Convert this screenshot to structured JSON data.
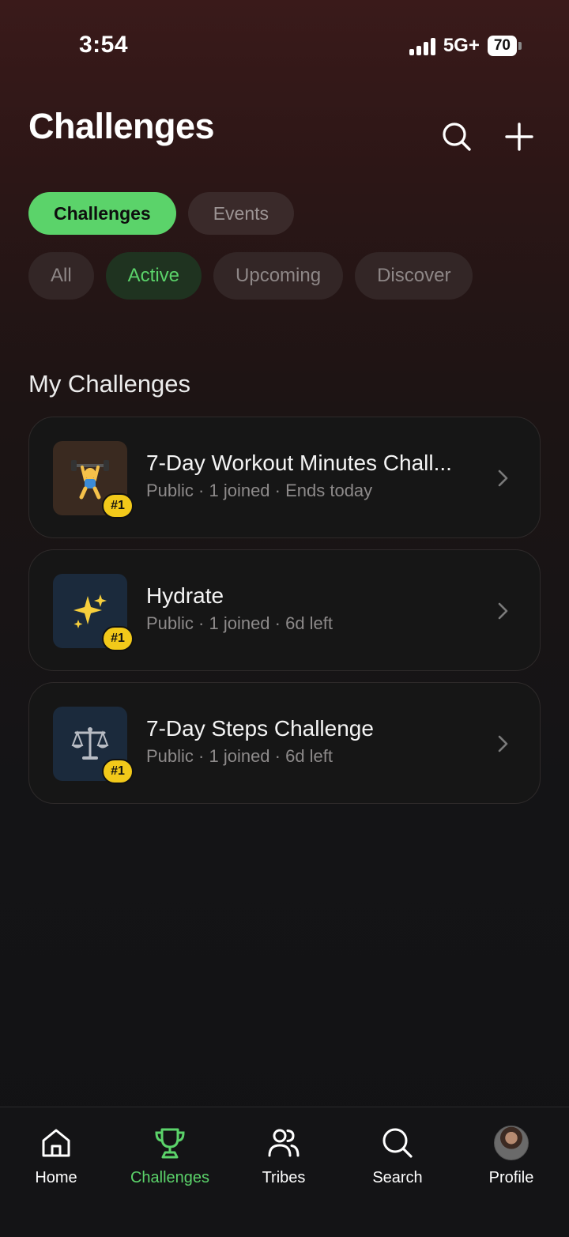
{
  "status": {
    "time": "3:54",
    "network": "5G+",
    "battery": "70"
  },
  "header": {
    "title": "Challenges",
    "search_icon": "search-icon",
    "add_icon": "plus-icon"
  },
  "segments": [
    {
      "label": "Challenges",
      "active": true
    },
    {
      "label": "Events",
      "active": false
    }
  ],
  "filters": [
    {
      "label": "All",
      "selected": false
    },
    {
      "label": "Active",
      "selected": true
    },
    {
      "label": "Upcoming",
      "selected": false
    },
    {
      "label": "Discover",
      "selected": false
    }
  ],
  "section": {
    "title": "My Challenges"
  },
  "challenges": [
    {
      "title": "7-Day Workout Minutes Chall...",
      "meta": "Public · 1 joined · Ends today",
      "icon": "🏋",
      "icon_name": "weightlifter-icon",
      "rank": "#1"
    },
    {
      "title": "Hydrate",
      "meta": "Public · 1 joined · 6d left",
      "icon": "✨",
      "icon_name": "sparkles-icon",
      "rank": "#1"
    },
    {
      "title": "7-Day Steps Challenge",
      "meta": "Public · 1 joined · 6d left",
      "icon": "⚖",
      "icon_name": "scales-icon",
      "rank": "#1"
    }
  ],
  "nav": [
    {
      "label": "Home",
      "icon": "home-icon",
      "active": false
    },
    {
      "label": "Challenges",
      "icon": "trophy-icon",
      "active": true
    },
    {
      "label": "Tribes",
      "icon": "people-icon",
      "active": false
    },
    {
      "label": "Search",
      "icon": "search-icon",
      "active": false
    },
    {
      "label": "Profile",
      "icon": "avatar",
      "active": false
    }
  ],
  "colors": {
    "accent": "#5bd36a",
    "badge": "#f2c91a",
    "card_bg": "#161616"
  }
}
